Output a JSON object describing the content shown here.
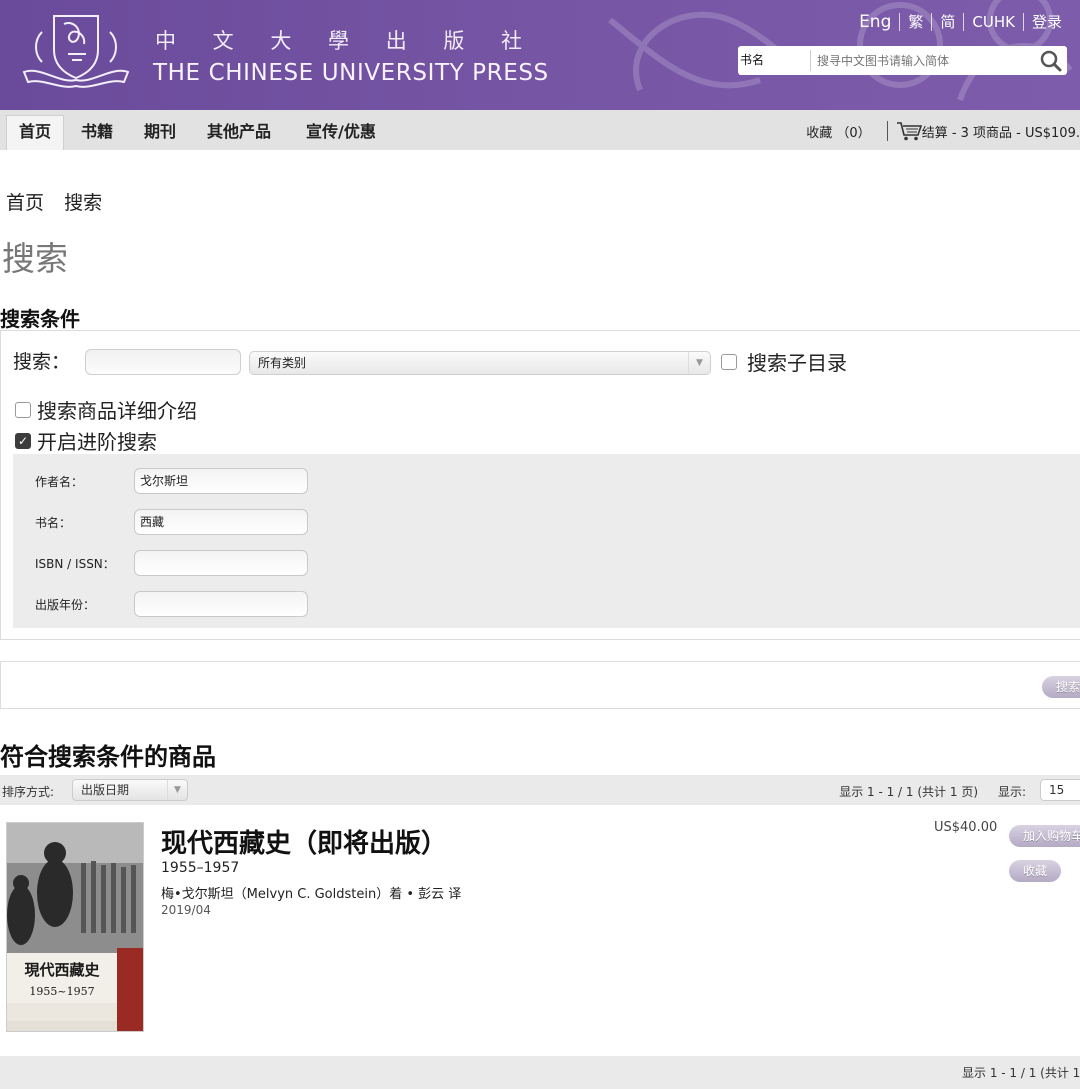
{
  "header": {
    "press_name_cn": "中 文 大 學 出 版 社",
    "press_name_en": "THE CHINESE UNIVERSITY PRESS",
    "top_links": [
      "Eng",
      "繁",
      "简",
      "CUHK",
      "登录"
    ],
    "search_scope": "书名",
    "search_placeholder": "搜寻中文图书请输入简体"
  },
  "nav": {
    "items": [
      "首页",
      "书籍",
      "期刊",
      "其他产品",
      "宣传/优惠"
    ],
    "favorites": "收藏 （0）",
    "cart": "结算 - 3 项商品 - US$109."
  },
  "breadcrumb": [
    "首页",
    "搜索"
  ],
  "page_title": "搜索",
  "criteria": {
    "heading": "搜索条件",
    "keyword_label": "搜索：",
    "keyword_value": "",
    "category_selected": "所有类别",
    "subdir_label": "搜索子目录",
    "detail_label": "搜索商品详细介绍",
    "advanced_label": "开启进阶搜索",
    "advanced": [
      {
        "label": "作者名：",
        "value": "戈尔斯坦"
      },
      {
        "label": "书名：",
        "value": "西藏"
      },
      {
        "label": "ISBN / ISSN：",
        "value": ""
      },
      {
        "label": "出版年份：",
        "value": ""
      }
    ],
    "search_button": "搜索"
  },
  "results": {
    "heading": "符合搜索条件的商品",
    "sort_label": "排序方式:",
    "sort_selected": "出版日期",
    "pagination": "显示 1 - 1 / 1 (共计 1 页)",
    "show_label": "显示:",
    "show_selected": "15",
    "bottom_pagination": "显示 1 - 1 / 1 (共计 1",
    "products": [
      {
        "title": "现代西藏史（即将出版）",
        "subtitle": "1955–1957",
        "authors": "梅•戈尔斯坦（Melvyn C. Goldstein）着 • 彭云 译",
        "date": "2019/04",
        "price": "US$40.00",
        "add_cart": "加入购物车",
        "favorite": "收藏",
        "cover_title": "現代西藏史",
        "cover_years": "1955~1957"
      }
    ]
  },
  "colors": {
    "header_purple": "#7655a5",
    "nav_gray": "#e2e2e2",
    "button_lavender": "#b4aac4"
  }
}
